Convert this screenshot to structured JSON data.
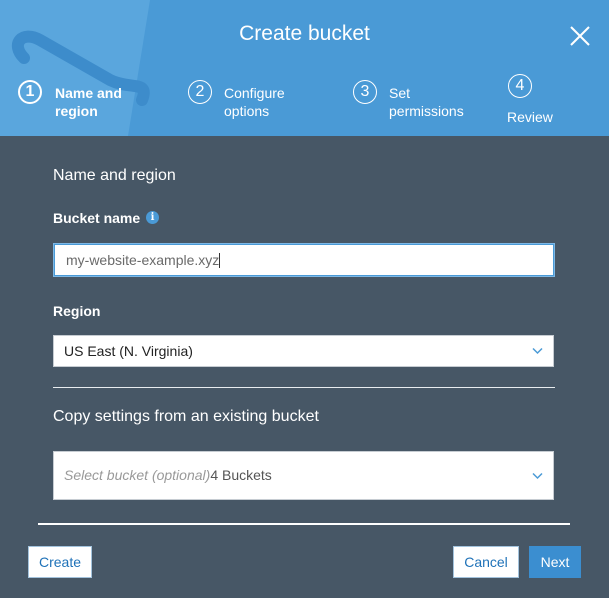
{
  "dialog": {
    "title": "Create bucket"
  },
  "steps": [
    {
      "number": "1",
      "label_line1": "Name and",
      "label_line2": "region"
    },
    {
      "number": "2",
      "label_line1": "Configure",
      "label_line2": "options"
    },
    {
      "number": "3",
      "label_line1": "Set",
      "label_line2": "permissions"
    },
    {
      "number": "4",
      "label_line1": "Review"
    }
  ],
  "form": {
    "section_title": "Name and region",
    "bucket_name_label": "Bucket name",
    "bucket_name_value": "my-website-example.xyz",
    "region_label": "Region",
    "region_value": "US East (N. Virginia)",
    "copy_title": "Copy settings from an existing bucket",
    "copy_placeholder": "Select bucket (optional)",
    "copy_count": "4 Buckets"
  },
  "footer": {
    "create_label": "Create",
    "cancel_label": "Cancel",
    "next_label": "Next"
  },
  "colors": {
    "header": "#4a9ad6",
    "body": "#475766",
    "primary": "#3b8ed0"
  }
}
